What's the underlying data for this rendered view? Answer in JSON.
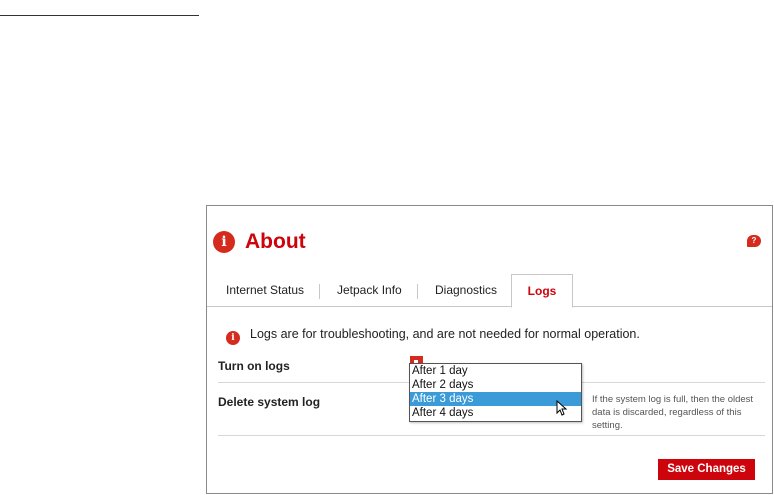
{
  "header": {
    "title": "About",
    "info_glyph": "i",
    "help_glyph": "?"
  },
  "tabs": [
    {
      "label": "Internet Status",
      "active": false
    },
    {
      "label": "Jetpack Info",
      "active": false
    },
    {
      "label": "Diagnostics",
      "active": false
    },
    {
      "label": "Logs",
      "active": true
    }
  ],
  "notice": {
    "text": "Logs are for troubleshooting, and are not needed for normal operation.",
    "icon": "info-icon"
  },
  "settings": {
    "turn_on_logs_label": "Turn on logs",
    "delete_system_log_label": "Delete system log",
    "delete_help": "If the system log is full, then the oldest data is discarded, regardless of this setting."
  },
  "dropdown": {
    "options": [
      "After 1 day",
      "After 2 days",
      "After 3 days",
      "After 4 days"
    ],
    "highlighted": "After 3 days"
  },
  "actions": {
    "save_label": "Save Changes"
  },
  "colors": {
    "accent": "#cd040b",
    "highlight": "#3b9bd8"
  }
}
